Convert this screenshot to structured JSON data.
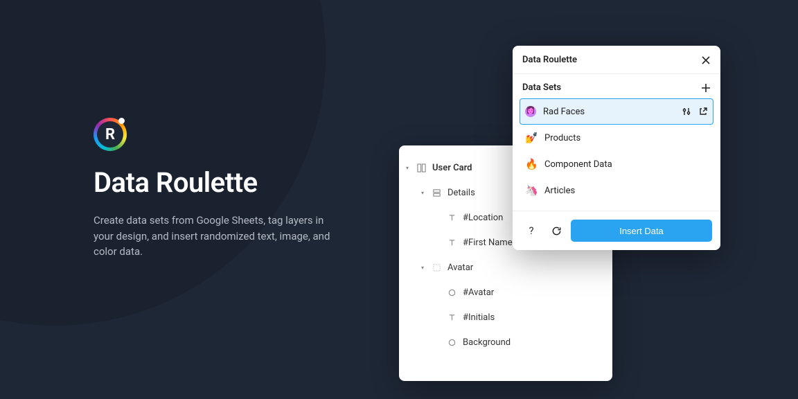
{
  "hero": {
    "logo_letter": "R",
    "title": "Data Roulette",
    "subtitle": "Create data sets from Google Sheets, tag layers in your design, and insert randomized text, image, and color data."
  },
  "layers": {
    "items": [
      {
        "depth": 1,
        "expanded": true,
        "icon": "frame",
        "label": "User Card",
        "root": true
      },
      {
        "depth": 2,
        "expanded": true,
        "icon": "vstack",
        "label": "Details"
      },
      {
        "depth": 3,
        "expanded": false,
        "icon": "text",
        "label": "#Location"
      },
      {
        "depth": 3,
        "expanded": false,
        "icon": "text",
        "label": "#First Name"
      },
      {
        "depth": 2,
        "expanded": true,
        "icon": "grid",
        "label": "Avatar"
      },
      {
        "depth": 3,
        "expanded": false,
        "icon": "circle",
        "label": "#Avatar"
      },
      {
        "depth": 3,
        "expanded": false,
        "icon": "text",
        "label": "#Initials"
      },
      {
        "depth": 3,
        "expanded": false,
        "icon": "circle",
        "label": "Background"
      }
    ]
  },
  "plugin": {
    "title": "Data Roulette",
    "section": "Data Sets",
    "sets": [
      {
        "emoji": "avatar",
        "label": "Rad Faces",
        "selected": true
      },
      {
        "emoji": "💅",
        "label": "Products"
      },
      {
        "emoji": "🔥",
        "label": "Component Data"
      },
      {
        "emoji": "🦄",
        "label": "Articles"
      }
    ],
    "help": "?",
    "insert_label": "Insert Data"
  }
}
